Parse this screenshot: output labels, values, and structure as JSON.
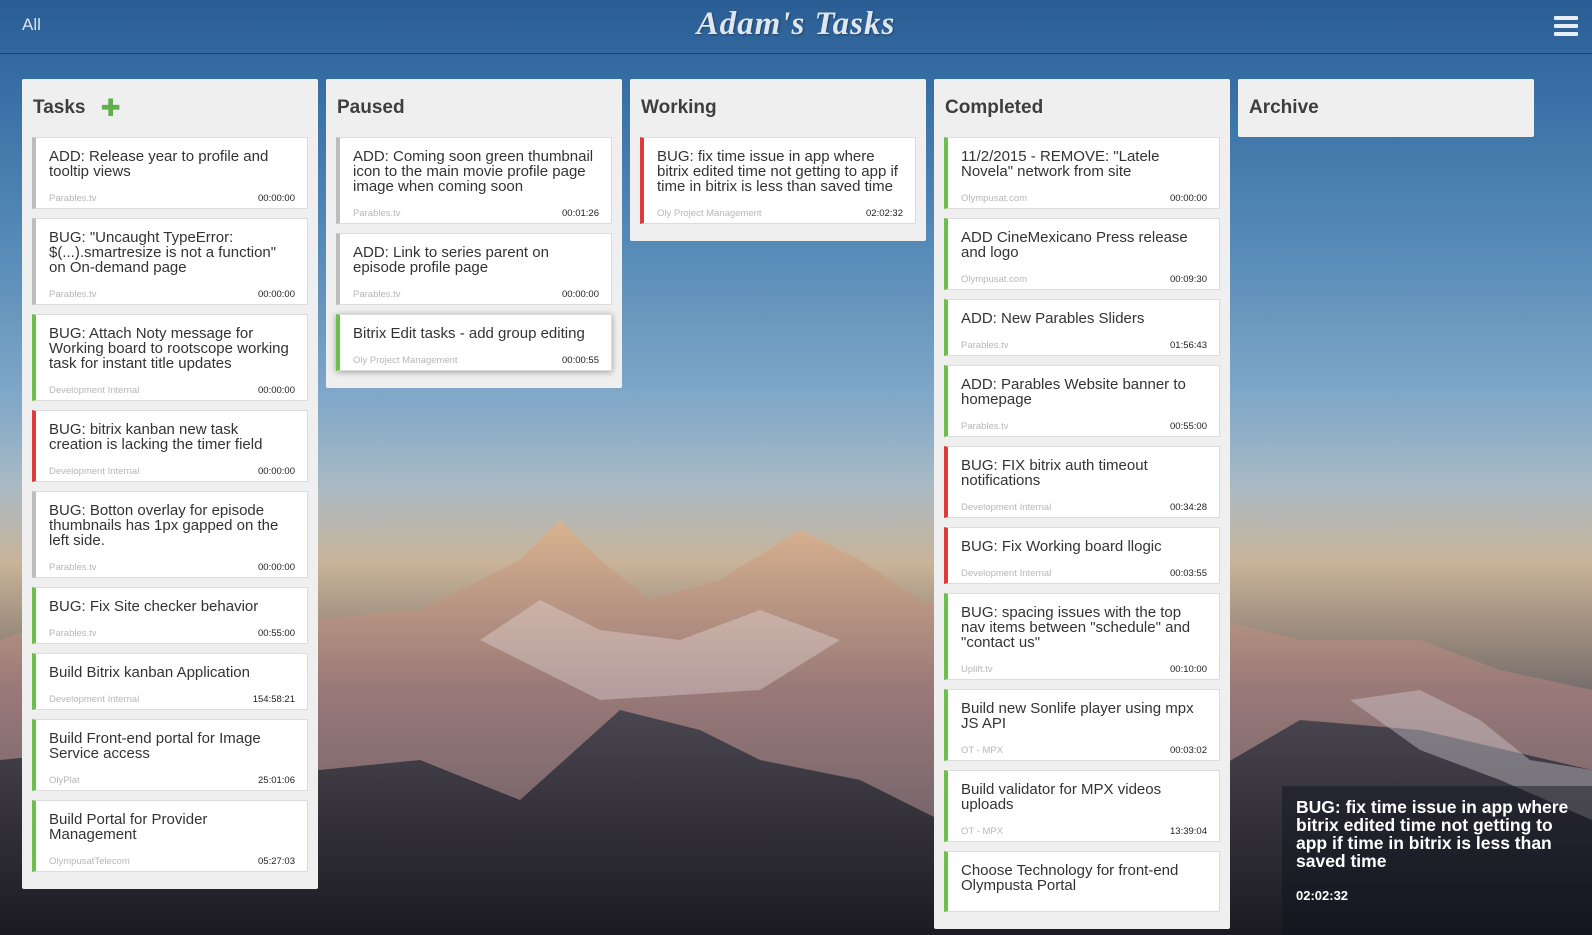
{
  "app": {
    "title": "Adam's Tasks",
    "nav_all": "All"
  },
  "columns": [
    {
      "title": "Tasks",
      "cards": [
        {
          "title": "ADD: Release year to profile and tooltip views",
          "project": "Parables.tv",
          "time": "00:00:00",
          "status": "gray"
        },
        {
          "title": "BUG: \"Uncaught TypeError: $(...).smartresize is not a function\" on On-demand page",
          "project": "Parables.tv",
          "time": "00:00:00",
          "status": "gray"
        },
        {
          "title": "BUG: Attach Noty message for Working board to rootscope working task for instant title updates",
          "project": "Development Internal",
          "time": "00:00:00",
          "status": "green"
        },
        {
          "title": "BUG: bitrix kanban new task creation is lacking the timer field",
          "project": "Development Internal",
          "time": "00:00:00",
          "status": "red"
        },
        {
          "title": "BUG: Botton overlay for episode thumbnails has 1px gapped on the left side.",
          "project": "Parables.tv",
          "time": "00:00:00",
          "status": "gray"
        },
        {
          "title": "BUG: Fix Site checker behavior",
          "project": "Parables.tv",
          "time": "00:55:00",
          "status": "green"
        },
        {
          "title": "Build Bitrix kanban Application",
          "project": "Development Internal",
          "time": "154:58:21",
          "status": "green"
        },
        {
          "title": "Build Front-end portal for Image Service access",
          "project": "OlyPlat",
          "time": "25:01:06",
          "status": "green"
        },
        {
          "title": "Build Portal for Provider Management",
          "project": "OlympusatTelecom",
          "time": "05:27:03",
          "status": "green"
        }
      ]
    },
    {
      "title": "Paused",
      "cards": [
        {
          "title": "ADD: Coming soon green thumbnail icon to the main movie profile page image when coming soon",
          "project": "Parables.tv",
          "time": "00:01:26",
          "status": "gray"
        },
        {
          "title": "ADD: Link to series parent on episode profile page",
          "project": "Parables.tv",
          "time": "00:00:00",
          "status": "gray"
        },
        {
          "title": "Bitrix Edit tasks - add group editing",
          "project": "Oly Project Management",
          "time": "00:00:55",
          "status": "green"
        }
      ]
    },
    {
      "title": "Working",
      "cards": [
        {
          "title": "BUG: fix time issue in app where bitrix edited time not getting to app if time in bitrix is less than saved time",
          "project": "Oly Project Management",
          "time": "02:02:32",
          "status": "red"
        }
      ]
    },
    {
      "title": "Completed",
      "cards": [
        {
          "title": "11/2/2015 - REMOVE: \"Latele Novela\" network from site",
          "project": "Olympusat.com",
          "time": "00:00:00",
          "status": "green"
        },
        {
          "title": "ADD CineMexicano Press release and logo",
          "project": "Olympusat.com",
          "time": "00:09:30",
          "status": "green"
        },
        {
          "title": "ADD: New Parables Sliders",
          "project": "Parables.tv",
          "time": "01:56:43",
          "status": "green"
        },
        {
          "title": "ADD: Parables Website banner to homepage",
          "project": "Parables.tv",
          "time": "00:55:00",
          "status": "green"
        },
        {
          "title": "BUG: FIX bitrix auth timeout notifications",
          "project": "Development Internal",
          "time": "00:34:28",
          "status": "red"
        },
        {
          "title": "BUG: Fix Working board llogic",
          "project": "Development Internal",
          "time": "00:03:55",
          "status": "red"
        },
        {
          "title": "BUG: spacing issues with the top nav items between \"schedule\" and \"contact us\"",
          "project": "Uplift.tv",
          "time": "00:10:00",
          "status": "green"
        },
        {
          "title": "Build new Sonlife player using mpx JS API",
          "project": "OT - MPX",
          "time": "00:03:02",
          "status": "green"
        },
        {
          "title": "Build validator for MPX videos uploads",
          "project": "OT - MPX",
          "time": "13:39:04",
          "status": "green"
        },
        {
          "title": "Choose Technology for front-end Olympusta Portal",
          "project": "",
          "time": "",
          "status": "green"
        }
      ]
    },
    {
      "title": "Archive",
      "cards": []
    }
  ],
  "notification": {
    "text": "BUG: fix time issue in app where bitrix edited time not getting to app if time in bitrix is less than saved time",
    "time": "02:02:32"
  },
  "colors": {
    "green": "#6cc14d",
    "red": "#e03a3a",
    "gray": "#bdbdbd",
    "add": "#5fb04a"
  },
  "icons": {
    "add": "plus-icon",
    "menu": "hamburger-menu-icon"
  }
}
